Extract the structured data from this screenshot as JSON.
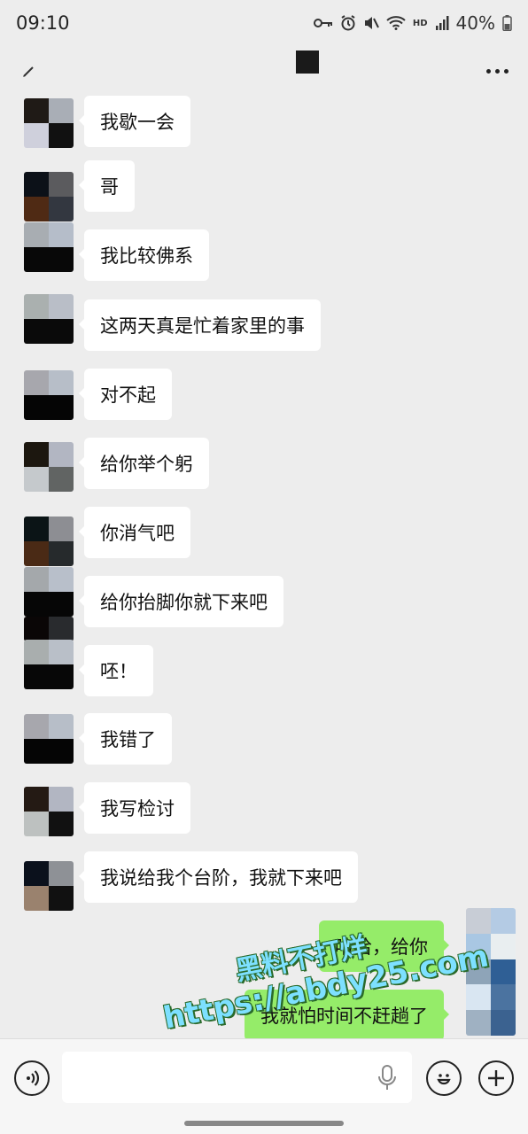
{
  "status_bar": {
    "time": "09:10",
    "network": "HD",
    "battery": "40%"
  },
  "header": {
    "back_icon": "pencil-back-icon",
    "more_icon": "more-dots-icon"
  },
  "messages": [
    {
      "from": "other",
      "text": "我歇一会"
    },
    {
      "from": "other",
      "text": "哥"
    },
    {
      "from": "other",
      "text": "我比较佛系"
    },
    {
      "from": "other",
      "text": "这两天真是忙着家里的事"
    },
    {
      "from": "other",
      "text": "对不起"
    },
    {
      "from": "other",
      "text": "给你举个躬"
    },
    {
      "from": "other",
      "text": "你消气吧"
    },
    {
      "from": "other",
      "text": "给你抬脚你就下来吧"
    },
    {
      "from": "other",
      "text": "呸！"
    },
    {
      "from": "other",
      "text": "我错了"
    },
    {
      "from": "other",
      "text": "我写检讨"
    },
    {
      "from": "other",
      "text": "我说给我个台阶，我就下来吧"
    },
    {
      "from": "me",
      "text": "哈哈，给你"
    },
    {
      "from": "me",
      "text": "我就怕时间不赶趟了"
    }
  ],
  "watermark": {
    "line1": "黑料不打烊",
    "line2": "https://abdy25.com"
  },
  "input_bar": {
    "voice_icon": "voice-icon",
    "mic_icon": "microphone-icon",
    "emoji_icon": "emoji-icon",
    "plus_icon": "plus-icon",
    "placeholder": ""
  }
}
